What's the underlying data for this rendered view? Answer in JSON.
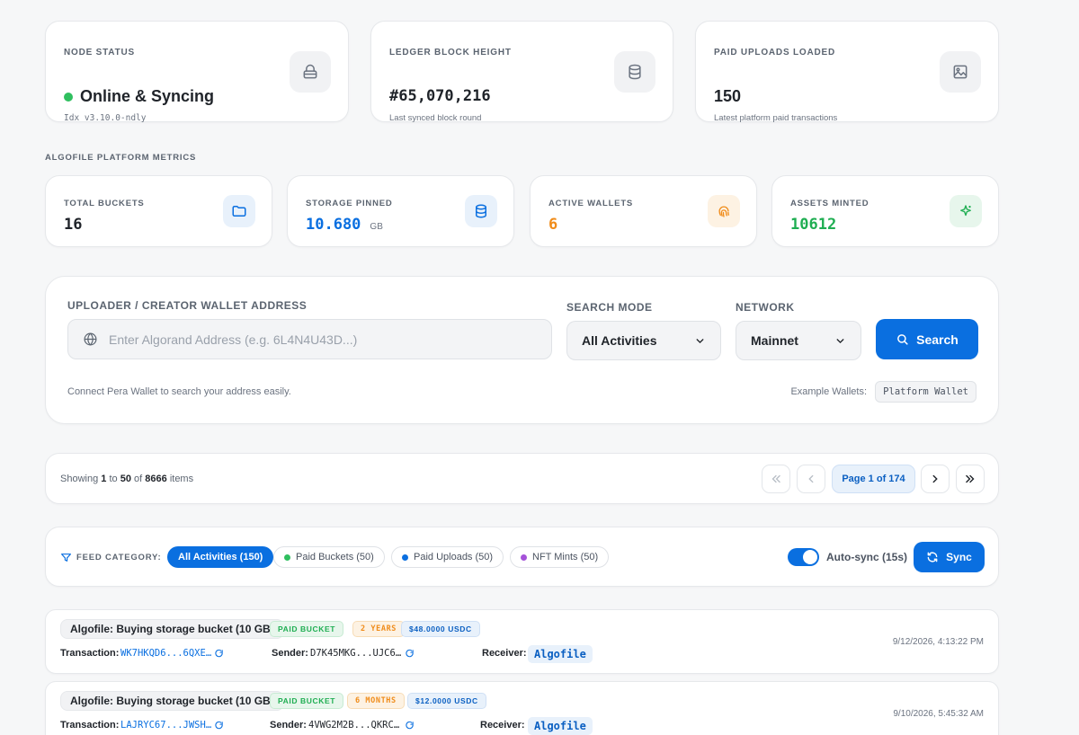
{
  "status_cards": [
    {
      "label": "NODE STATUS",
      "value": "Online & Syncing",
      "sub": "Idx v3.10.0-ndly",
      "icon": "lock-icon"
    },
    {
      "label": "LEDGER BLOCK HEIGHT",
      "value": "#65,070,216",
      "sub": "Last synced block round",
      "icon": "database-icon"
    },
    {
      "label": "PAID UPLOADS LOADED",
      "value": "150",
      "sub": "Latest platform paid transactions",
      "icon": "image-icon"
    }
  ],
  "metrics_heading": "ALGOFILE PLATFORM METRICS",
  "metrics": [
    {
      "label": "TOTAL BUCKETS",
      "value": "16",
      "unit": "",
      "color": "#1f2329",
      "icon": "folder-icon"
    },
    {
      "label": "STORAGE PINNED",
      "value": "10.680",
      "unit": "GB",
      "color": "#0a6fe0",
      "icon": "database-icon"
    },
    {
      "label": "ACTIVE WALLETS",
      "value": "6",
      "unit": "",
      "color": "#f08c1a",
      "icon": "fingerprint-icon"
    },
    {
      "label": "ASSETS MINTED",
      "value": "10612",
      "unit": "",
      "color": "#1fae52",
      "icon": "sparkle-icon"
    }
  ],
  "search": {
    "address_label": "UPLOADER / CREATOR WALLET ADDRESS",
    "address_placeholder": "Enter Algorand Address (e.g. 6L4N4U43D...)",
    "mode_label": "SEARCH MODE",
    "mode_value": "All Activities",
    "network_label": "NETWORK",
    "network_value": "Mainnet",
    "search_button": "Search",
    "hint": "Connect Pera Wallet to search your address easily.",
    "example_label": "Example Wallets:",
    "example_wallet": "Platform Wallet"
  },
  "pagination": {
    "showing_prefix": "Showing",
    "from": "1",
    "to_word": "to",
    "to": "50",
    "of_word": "of",
    "total": "8666",
    "items_word": "items",
    "page_label": "Page 1 of 174"
  },
  "feed": {
    "category_label": "FEED CATEGORY:",
    "filters": [
      {
        "label": "All Activities (150)",
        "active": true,
        "dot": ""
      },
      {
        "label": "Paid Buckets (50)",
        "active": false,
        "dot": "#2fbf5f"
      },
      {
        "label": "Paid Uploads (50)",
        "active": false,
        "dot": "#0a6fe0"
      },
      {
        "label": "NFT Mints (50)",
        "active": false,
        "dot": "#a552d9"
      }
    ],
    "autosync_label": "Auto-sync (15s)",
    "sync_button": "Sync"
  },
  "transactions": [
    {
      "title": "Algofile: Buying storage bucket (10 GB)",
      "type_tag": "PAID BUCKET",
      "duration_tag": "2 YEARS",
      "amount_tag": "$48.0000 USDC",
      "tx_label": "Transaction:",
      "tx_id": "WK7HKQD6...6QXE…",
      "sender_label": "Sender:",
      "sender": "D7K45MKG...UJC6…",
      "receiver_label": "Receiver:",
      "receiver": "Algofile",
      "date": "9/12/2026, 4:13:22 PM"
    },
    {
      "title": "Algofile: Buying storage bucket (10 GB)",
      "type_tag": "PAID BUCKET",
      "duration_tag": "6 MONTHS",
      "amount_tag": "$12.0000 USDC",
      "tx_label": "Transaction:",
      "tx_id": "LAJRYC67...JWSH…",
      "sender_label": "Sender:",
      "sender": "4VWG2M2B...QKRC…",
      "receiver_label": "Receiver:",
      "receiver": "Algofile",
      "date": "9/10/2026, 5:45:32 AM"
    }
  ]
}
